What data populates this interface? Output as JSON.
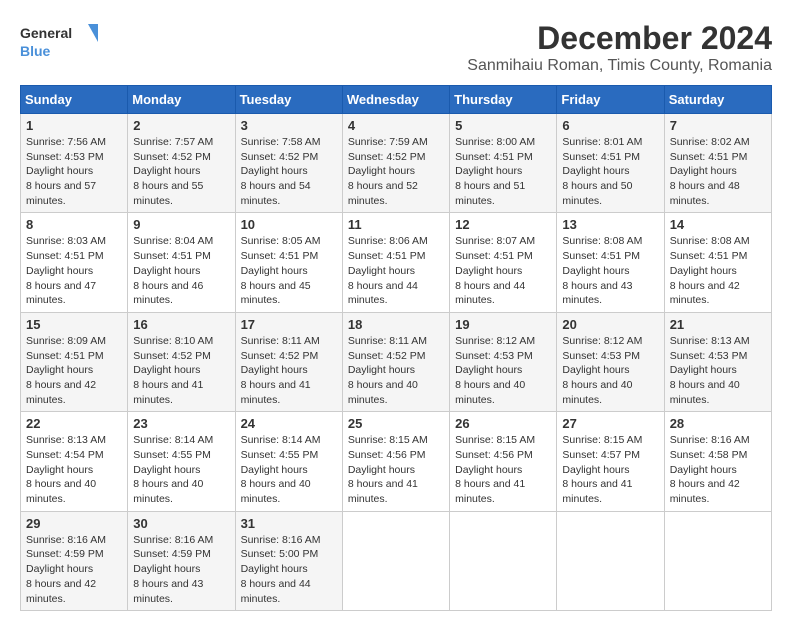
{
  "logo": {
    "line1": "General",
    "line2": "Blue"
  },
  "title": "December 2024",
  "subtitle": "Sanmihaiu Roman, Timis County, Romania",
  "weekdays": [
    "Sunday",
    "Monday",
    "Tuesday",
    "Wednesday",
    "Thursday",
    "Friday",
    "Saturday"
  ],
  "weeks": [
    [
      {
        "day": "1",
        "sunrise": "7:56 AM",
        "sunset": "4:53 PM",
        "daylight": "8 hours and 57 minutes."
      },
      {
        "day": "2",
        "sunrise": "7:57 AM",
        "sunset": "4:52 PM",
        "daylight": "8 hours and 55 minutes."
      },
      {
        "day": "3",
        "sunrise": "7:58 AM",
        "sunset": "4:52 PM",
        "daylight": "8 hours and 54 minutes."
      },
      {
        "day": "4",
        "sunrise": "7:59 AM",
        "sunset": "4:52 PM",
        "daylight": "8 hours and 52 minutes."
      },
      {
        "day": "5",
        "sunrise": "8:00 AM",
        "sunset": "4:51 PM",
        "daylight": "8 hours and 51 minutes."
      },
      {
        "day": "6",
        "sunrise": "8:01 AM",
        "sunset": "4:51 PM",
        "daylight": "8 hours and 50 minutes."
      },
      {
        "day": "7",
        "sunrise": "8:02 AM",
        "sunset": "4:51 PM",
        "daylight": "8 hours and 48 minutes."
      }
    ],
    [
      {
        "day": "8",
        "sunrise": "8:03 AM",
        "sunset": "4:51 PM",
        "daylight": "8 hours and 47 minutes."
      },
      {
        "day": "9",
        "sunrise": "8:04 AM",
        "sunset": "4:51 PM",
        "daylight": "8 hours and 46 minutes."
      },
      {
        "day": "10",
        "sunrise": "8:05 AM",
        "sunset": "4:51 PM",
        "daylight": "8 hours and 45 minutes."
      },
      {
        "day": "11",
        "sunrise": "8:06 AM",
        "sunset": "4:51 PM",
        "daylight": "8 hours and 44 minutes."
      },
      {
        "day": "12",
        "sunrise": "8:07 AM",
        "sunset": "4:51 PM",
        "daylight": "8 hours and 44 minutes."
      },
      {
        "day": "13",
        "sunrise": "8:08 AM",
        "sunset": "4:51 PM",
        "daylight": "8 hours and 43 minutes."
      },
      {
        "day": "14",
        "sunrise": "8:08 AM",
        "sunset": "4:51 PM",
        "daylight": "8 hours and 42 minutes."
      }
    ],
    [
      {
        "day": "15",
        "sunrise": "8:09 AM",
        "sunset": "4:51 PM",
        "daylight": "8 hours and 42 minutes."
      },
      {
        "day": "16",
        "sunrise": "8:10 AM",
        "sunset": "4:52 PM",
        "daylight": "8 hours and 41 minutes."
      },
      {
        "day": "17",
        "sunrise": "8:11 AM",
        "sunset": "4:52 PM",
        "daylight": "8 hours and 41 minutes."
      },
      {
        "day": "18",
        "sunrise": "8:11 AM",
        "sunset": "4:52 PM",
        "daylight": "8 hours and 40 minutes."
      },
      {
        "day": "19",
        "sunrise": "8:12 AM",
        "sunset": "4:53 PM",
        "daylight": "8 hours and 40 minutes."
      },
      {
        "day": "20",
        "sunrise": "8:12 AM",
        "sunset": "4:53 PM",
        "daylight": "8 hours and 40 minutes."
      },
      {
        "day": "21",
        "sunrise": "8:13 AM",
        "sunset": "4:53 PM",
        "daylight": "8 hours and 40 minutes."
      }
    ],
    [
      {
        "day": "22",
        "sunrise": "8:13 AM",
        "sunset": "4:54 PM",
        "daylight": "8 hours and 40 minutes."
      },
      {
        "day": "23",
        "sunrise": "8:14 AM",
        "sunset": "4:55 PM",
        "daylight": "8 hours and 40 minutes."
      },
      {
        "day": "24",
        "sunrise": "8:14 AM",
        "sunset": "4:55 PM",
        "daylight": "8 hours and 40 minutes."
      },
      {
        "day": "25",
        "sunrise": "8:15 AM",
        "sunset": "4:56 PM",
        "daylight": "8 hours and 41 minutes."
      },
      {
        "day": "26",
        "sunrise": "8:15 AM",
        "sunset": "4:56 PM",
        "daylight": "8 hours and 41 minutes."
      },
      {
        "day": "27",
        "sunrise": "8:15 AM",
        "sunset": "4:57 PM",
        "daylight": "8 hours and 41 minutes."
      },
      {
        "day": "28",
        "sunrise": "8:16 AM",
        "sunset": "4:58 PM",
        "daylight": "8 hours and 42 minutes."
      }
    ],
    [
      {
        "day": "29",
        "sunrise": "8:16 AM",
        "sunset": "4:59 PM",
        "daylight": "8 hours and 42 minutes."
      },
      {
        "day": "30",
        "sunrise": "8:16 AM",
        "sunset": "4:59 PM",
        "daylight": "8 hours and 43 minutes."
      },
      {
        "day": "31",
        "sunrise": "8:16 AM",
        "sunset": "5:00 PM",
        "daylight": "8 hours and 44 minutes."
      },
      null,
      null,
      null,
      null
    ]
  ]
}
